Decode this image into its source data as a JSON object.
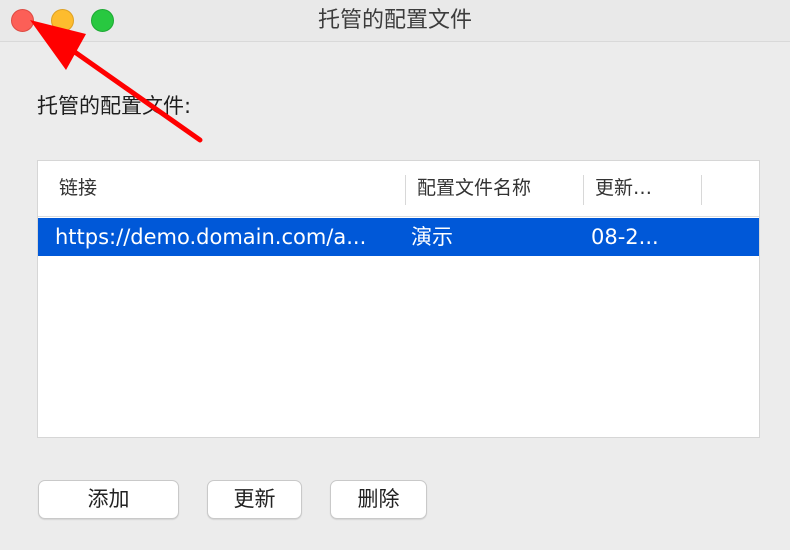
{
  "window": {
    "title": "托管的配置文件"
  },
  "heading": "托管的配置文件:",
  "table": {
    "columns": [
      "链接",
      "配置文件名称",
      "更新…"
    ],
    "rows": [
      {
        "link": "https://demo.domain.com/a...",
        "name": "演示",
        "updated": "08-2..."
      }
    ]
  },
  "buttons": {
    "add": "添加",
    "update": "更新",
    "delete": "删除"
  },
  "colors": {
    "selection": "#0058d8",
    "annotation_arrow": "#ff0000"
  }
}
